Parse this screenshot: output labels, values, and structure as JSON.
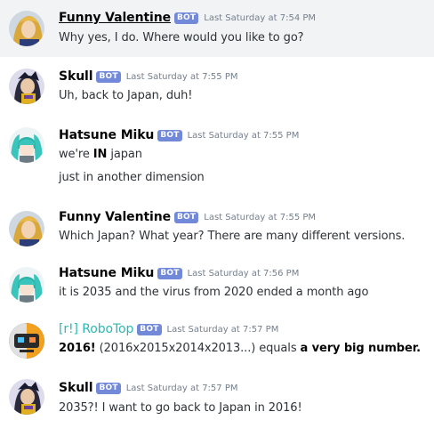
{
  "channel": {
    "messages": [
      {
        "username": "Funny Valentine",
        "badge": "BOT",
        "timestamp": "Last Saturday at 7:54 PM",
        "lines": [
          "Why yes, I do. Where would you like to go?"
        ]
      },
      {
        "username": "Skull",
        "badge": "BOT",
        "timestamp": "Last Saturday at 7:55 PM",
        "lines": [
          "Uh, back to Japan, duh!"
        ]
      },
      {
        "username": "Hatsune Miku",
        "badge": "BOT",
        "timestamp": "Last Saturday at 7:55 PM",
        "line1_pre": "we're ",
        "line1_bold": "IN",
        "line1_post": " japan",
        "line2": "just in another dimension"
      },
      {
        "username": "Funny Valentine",
        "badge": "BOT",
        "timestamp": "Last Saturday at 7:55 PM",
        "lines": [
          "Which Japan? What year? There are many different versions."
        ]
      },
      {
        "username": "Hatsune Miku",
        "badge": "BOT",
        "timestamp": "Last Saturday at 7:56 PM",
        "lines": [
          "it is 2035 and the virus from 2020 ended a month ago"
        ]
      },
      {
        "username": "[r!] RoboTop",
        "badge": "BOT",
        "timestamp": "Last Saturday at 7:57 PM",
        "bold1": "2016!",
        "mid": " (2016x2015x2014x2013...) equals ",
        "bold2": "a very big number."
      },
      {
        "username": "Skull",
        "badge": "BOT",
        "timestamp": "Last Saturday at 7:57 PM",
        "lines": [
          "2035?! I want to go back to Japan in 2016!"
        ]
      }
    ]
  },
  "colors": {
    "bot_badge": "#7289da",
    "robotop_name": "#2fb7b1",
    "highlight_row": "#f2f3f5",
    "timestamp": "#747f8d"
  },
  "icons": {
    "funny_valentine": "funny-valentine-avatar-icon",
    "skull": "skull-avatar-icon",
    "hatsune_miku": "hatsune-miku-avatar-icon",
    "robotop": "robotop-avatar-icon"
  }
}
